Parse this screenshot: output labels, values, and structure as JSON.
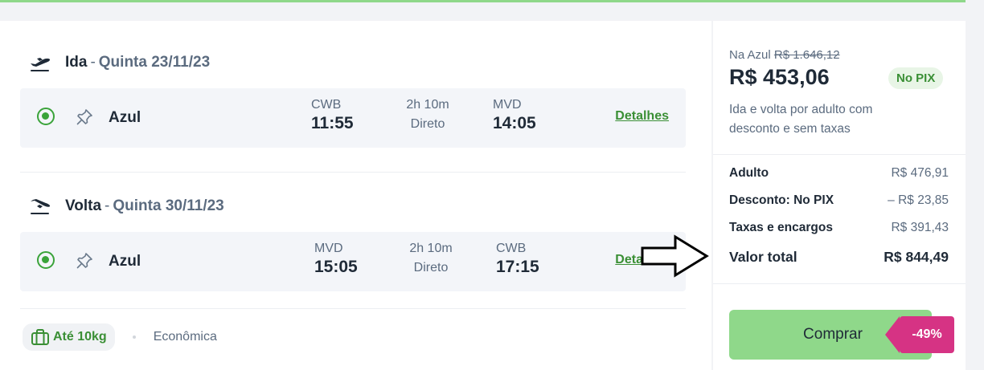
{
  "outbound": {
    "label": "Ida",
    "date": "Quinta 23/11/23",
    "flight": {
      "airline": "Azul",
      "origin_code": "CWB",
      "departure_time": "11:55",
      "duration": "2h 10m",
      "stops": "Direto",
      "destination_code": "MVD",
      "arrival_time": "14:05",
      "details_label": "Detalhes"
    }
  },
  "return": {
    "label": "Volta",
    "date": "Quinta 30/11/23",
    "flight": {
      "airline": "Azul",
      "origin_code": "MVD",
      "departure_time": "15:05",
      "duration": "2h 10m",
      "stops": "Direto",
      "destination_code": "CWB",
      "arrival_time": "17:15",
      "details_label": "Detalhes"
    }
  },
  "footer": {
    "baggage": "Até 10kg",
    "cabin_class": "Econômica"
  },
  "summary": {
    "airline_price_label": "Na Azul",
    "airline_price": "R$ 1.646,12",
    "price": "R$ 453,06",
    "badge": "No PIX",
    "description": "Ida e volta por adulto com desconto e sem taxas",
    "breakdown": [
      {
        "label": "Adulto",
        "value": "R$ 476,91"
      },
      {
        "label": "Desconto: No PIX",
        "value": "– R$ 23,85"
      },
      {
        "label": "Taxas e encargos",
        "value": "R$ 391,43"
      }
    ],
    "total_label": "Valor total",
    "total_value": "R$ 844,49",
    "buy_label": "Comprar",
    "discount_tag": "-49%"
  },
  "colors": {
    "accent_green": "#8fd88a",
    "link_green": "#3a8f35",
    "discount_pink": "#d63384"
  },
  "icons": {
    "departure": "plane-takeoff-icon",
    "arrival": "plane-landing-icon",
    "pin": "pin-icon",
    "baggage": "briefcase-icon",
    "pointer": "arrow-right-icon"
  }
}
